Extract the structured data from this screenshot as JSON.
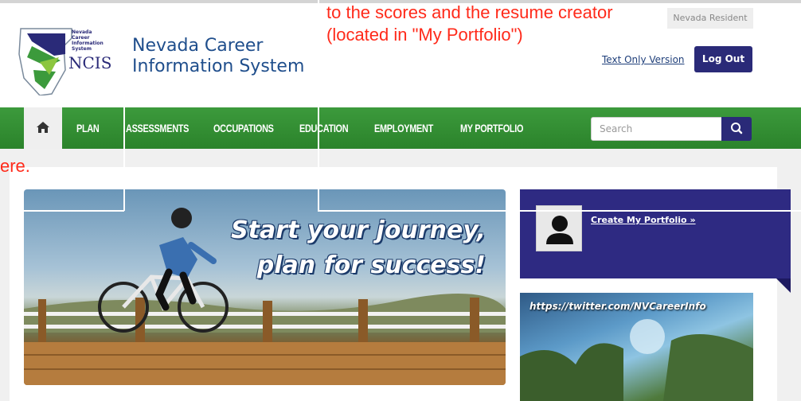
{
  "annotations": {
    "top": [
      "to the scores and the resume creator",
      "(located in \"My Portfolio\")"
    ],
    "left": "ere."
  },
  "header": {
    "site_title_line1": "Nevada Career",
    "site_title_line2": "Information System",
    "logo_text": "NCIS",
    "logo_small": [
      "Nevada",
      "Career",
      "Information",
      "System"
    ],
    "user_name": "Nevada Resident",
    "text_only_label": "Text Only Version",
    "logout_label": "Log Out"
  },
  "nav": {
    "items": [
      {
        "label": "PLAN"
      },
      {
        "label": "ASSESSMENTS"
      },
      {
        "label": "OCCUPATIONS"
      },
      {
        "label": "EDUCATION"
      },
      {
        "label": "EMPLOYMENT"
      },
      {
        "label": "MY PORTFOLIO"
      }
    ],
    "search_placeholder": "Search"
  },
  "hero": {
    "line1": "Start your journey,",
    "line2": "plan for success!"
  },
  "portfolio": {
    "link_label": "Create My Portfolio »"
  },
  "twitter": {
    "url": "https://twitter.com/NVCareerInfo"
  },
  "colors": {
    "nav_green": "#2b832b",
    "brand_navy": "#2a2a78",
    "portfolio_purple": "#2e2a82",
    "annotation_red": "#ff2a1a",
    "title_blue": "#1f4e8c"
  }
}
